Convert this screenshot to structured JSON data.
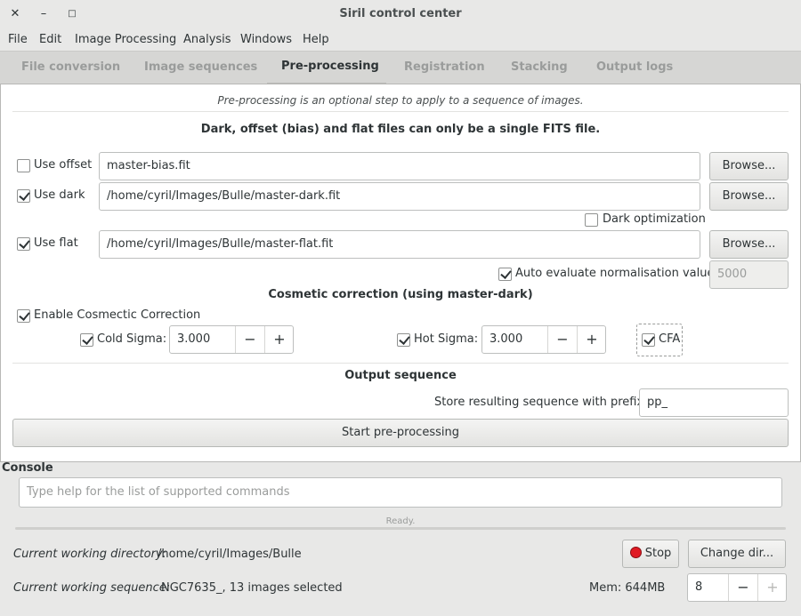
{
  "window": {
    "title": "Siril control center"
  },
  "menubar": [
    "File",
    "Edit",
    "Image Processing",
    "Analysis",
    "Windows",
    "Help"
  ],
  "tabs": [
    "File conversion",
    "Image sequences",
    "Pre-processing",
    "Registration",
    "Stacking",
    "Output logs"
  ],
  "active_tab": "Pre-processing",
  "preprocessing": {
    "intro": "Pre-processing is an optional step to apply to a sequence of images.",
    "files_note": "Dark, offset (bias) and flat files can only be a single FITS file.",
    "offset": {
      "label": "Use offset",
      "checked": false,
      "path": "master-bias.fit",
      "browse": "Browse..."
    },
    "dark": {
      "label": "Use dark",
      "checked": true,
      "path": "/home/cyril/Images/Bulle/master-dark.fit",
      "browse": "Browse..."
    },
    "dark_optimization": {
      "label": "Dark optimization",
      "checked": false
    },
    "flat": {
      "label": "Use flat",
      "checked": true,
      "path": "/home/cyril/Images/Bulle/master-flat.fit",
      "browse": "Browse..."
    },
    "auto_norm": {
      "label": "Auto evaluate normalisation value",
      "checked": true,
      "value": "5000"
    },
    "cosmetic": {
      "heading": "Cosmetic correction (using master-dark)",
      "enable_label": "Enable Cosmectic Correction",
      "enabled": true,
      "cold": {
        "label": "Cold Sigma:",
        "checked": true,
        "value": "3.000"
      },
      "hot": {
        "label": "Hot Sigma:",
        "checked": true,
        "value": "3.000"
      },
      "cfa": {
        "label": "CFA",
        "checked": true
      }
    },
    "output": {
      "heading": "Output sequence",
      "prefix_label": "Store resulting sequence with prefix:",
      "prefix_value": "pp_"
    },
    "start_button": "Start pre-processing"
  },
  "console": {
    "label": "Console",
    "placeholder": "Type help for the list of supported commands",
    "status": "Ready.",
    "progress": 0,
    "stop_button": "Stop",
    "change_dir_button": "Change dir...",
    "cwd_label": "Current working directory:",
    "cwd_value": "/home/cyril/Images/Bulle",
    "seq_label": "Current working sequence:",
    "seq_value": "NGC7635_, 13 images selected",
    "mem": "Mem: 644MB",
    "threads_value": "8"
  },
  "icons": {
    "close": "close-icon",
    "minimize": "minimize-icon",
    "maximize": "maximize-icon",
    "stop": "stop-icon"
  },
  "colors": {
    "stop_red": "#e01b24",
    "accent_blue": "#5d8fc4"
  }
}
